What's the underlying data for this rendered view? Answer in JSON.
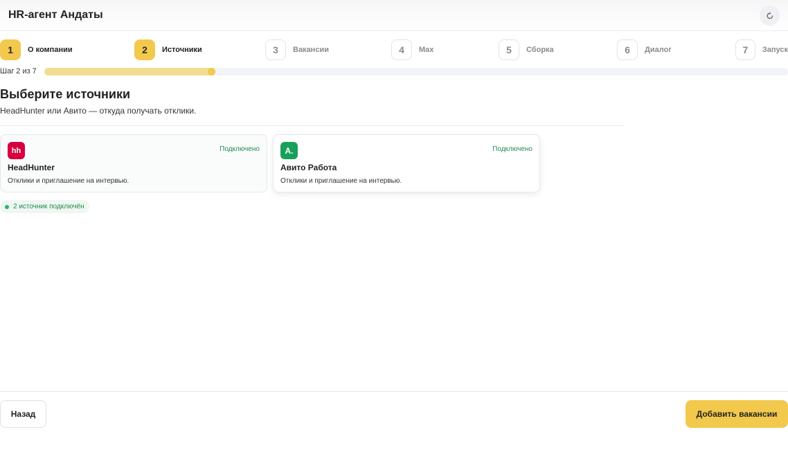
{
  "header": {
    "title": "HR-агент Андаты",
    "reset_icon": "refresh-icon"
  },
  "stepper": {
    "steps": [
      {
        "number": "1",
        "label": "О компании",
        "active": true
      },
      {
        "number": "2",
        "label": "Источники",
        "active": true
      },
      {
        "number": "3",
        "label": "Вакансии",
        "active": false
      },
      {
        "number": "4",
        "label": "Max",
        "active": false
      },
      {
        "number": "5",
        "label": "Сборка",
        "active": false
      },
      {
        "number": "6",
        "label": "Диалог",
        "active": false
      },
      {
        "number": "7",
        "label": "Запуск",
        "active": false
      }
    ],
    "progress_text": "Шаг 2 из 7",
    "progress_fraction": 0.23
  },
  "main": {
    "title": "Выберите источники",
    "subtitle": "HeadHunter или Авито — откуда получать отклики.",
    "sources": [
      {
        "name": "HeadHunter",
        "description": "Отклики и приглашение на интервью.",
        "status": "Подключено",
        "logo_text": "hh",
        "logo_color": "#d6003f"
      },
      {
        "name": "Авито Работа",
        "description": "Отклики и приглашение на интервью.",
        "status": "Подключено",
        "logo_text": "A.",
        "logo_color": "#18a05a"
      }
    ],
    "connected_summary": "2 источник подключён"
  },
  "footer": {
    "back_label": "Назад",
    "next_label": "Добавить вакансии"
  },
  "colors": {
    "accent": "#f2c94c",
    "success": "#1f8a4c"
  }
}
